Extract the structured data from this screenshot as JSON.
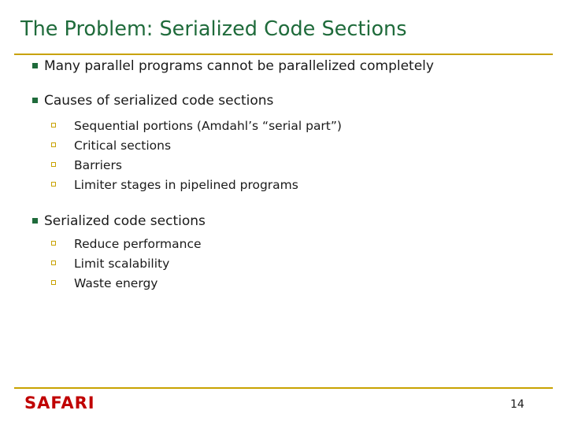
{
  "slide": {
    "title": "The Problem: Serialized Code Sections",
    "bullets": [
      {
        "level": 1,
        "text": "Many parallel programs cannot be parallelized completely"
      },
      {
        "level": 1,
        "text": "Causes of serialized code sections"
      },
      {
        "level": 2,
        "text": "Sequential portions (Amdahl’s “serial part”)"
      },
      {
        "level": 2,
        "text": "Critical sections"
      },
      {
        "level": 2,
        "text": "Barriers"
      },
      {
        "level": 2,
        "text": "Limiter stages in pipelined programs"
      },
      {
        "level": 1,
        "text": "Serialized code sections"
      },
      {
        "level": 2,
        "text": "Reduce performance"
      },
      {
        "level": 2,
        "text": "Limit scalability"
      },
      {
        "level": 2,
        "text": "Waste energy"
      }
    ],
    "footer": {
      "logo_text": "SAFARI",
      "page_number": "14"
    },
    "colors": {
      "title": "#1F6B3B",
      "rule": "#C8A200",
      "logo": "#C00000",
      "body_text": "#1A1A1A"
    }
  }
}
